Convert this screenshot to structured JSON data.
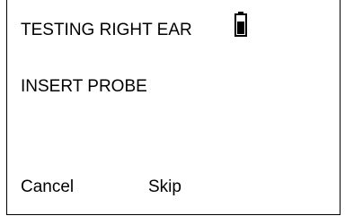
{
  "screen": {
    "status_text": "TESTING RIGHT EAR",
    "prompt_text": "INSERT PROBE",
    "battery_icon": "battery-icon"
  },
  "softkeys": {
    "left_label": "Cancel",
    "right_label": "Skip"
  }
}
